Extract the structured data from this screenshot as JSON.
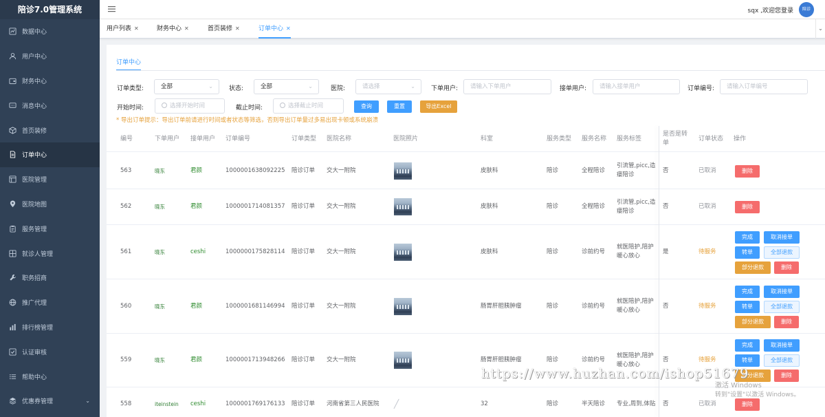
{
  "app": {
    "title": "陪诊7.0管理系统"
  },
  "sidebar": {
    "items": [
      {
        "label": "数据中心",
        "icon": "chart-icon"
      },
      {
        "label": "用户中心",
        "icon": "user-icon"
      },
      {
        "label": "财务中心",
        "icon": "wallet-icon"
      },
      {
        "label": "消息中心",
        "icon": "message-icon"
      },
      {
        "label": "首页装修",
        "icon": "box-icon"
      },
      {
        "label": "订单中心",
        "icon": "document-icon",
        "active": true
      },
      {
        "label": "医院管理",
        "icon": "hospital-icon"
      },
      {
        "label": "医院地图",
        "icon": "map-pin-icon"
      },
      {
        "label": "服务管理",
        "icon": "clipboard-icon"
      },
      {
        "label": "就诊人管理",
        "icon": "patients-icon"
      },
      {
        "label": "职务招商",
        "icon": "tool-icon"
      },
      {
        "label": "推广代理",
        "icon": "globe-icon"
      },
      {
        "label": "排行榜管理",
        "icon": "bar-chart-icon"
      },
      {
        "label": "认证审核",
        "icon": "check-square-icon"
      },
      {
        "label": "帮助中心",
        "icon": "list-icon"
      },
      {
        "label": "优惠券管理",
        "icon": "coupon-icon",
        "has_submenu": true
      }
    ]
  },
  "header": {
    "welcome": "sqx ,欢迎您登录",
    "avatar_text": "陪诊"
  },
  "tabs": [
    {
      "label": "用户列表"
    },
    {
      "label": "财务中心"
    },
    {
      "label": "首页装修"
    },
    {
      "label": "订单中心",
      "active": true
    }
  ],
  "panel": {
    "title": "订单中心"
  },
  "filters": {
    "order_type": {
      "label": "订单类型:",
      "value": "全部"
    },
    "status": {
      "label": "状态:",
      "value": "全部"
    },
    "hospital": {
      "label": "医院:",
      "placeholder": "请选择"
    },
    "order_user": {
      "label": "下单用户:",
      "placeholder": "请输入下单用户"
    },
    "accept_user": {
      "label": "接单用户:",
      "placeholder": "请输入接单用户"
    },
    "order_no": {
      "label": "订单编号:",
      "placeholder": "请输入订单编号"
    },
    "start_time": {
      "label": "开始时间:",
      "placeholder": "选择开始时间"
    },
    "end_time": {
      "label": "截止时间:",
      "placeholder": "选择截止时间"
    },
    "buttons": {
      "query": "查询",
      "reset": "重置",
      "export": "导出Excel"
    },
    "tip": "* 导出订单提示：导出订单前请进行时间或者状态等筛选，否则导出订单量过多易出现卡顿或系统崩溃"
  },
  "table": {
    "columns": {
      "id": "编号",
      "order_user": "下单用户",
      "accept_user": "接单用户",
      "order_no": "订单编号",
      "order_type": "订单类型",
      "hospital": "医院名称",
      "photo": "医院照片",
      "dept": "科室",
      "service_type": "服务类型",
      "service_name": "服务名称",
      "service_tag": "服务标签",
      "transfer": "是否是转单",
      "status": "订单状态",
      "actions": "操作"
    },
    "action_labels": {
      "complete": "完成",
      "cancel_accept": "取消接单",
      "transfer": "转单",
      "refund_all": "全部退款",
      "refund_part": "部分退款",
      "delete": "删除"
    },
    "rows": [
      {
        "id": "563",
        "order_user": "晓东",
        "accept_user": "君颜",
        "order_no": "1000001638092225",
        "order_type": "陪诊订单",
        "hospital": "交大一附院",
        "has_photo": true,
        "dept": "皮肤科",
        "service_type": "陪诊",
        "service_name": "全程陪诊",
        "service_tag": "引流管,picc,造瘘陪诊",
        "transfer": "否",
        "status": "已取消"
      },
      {
        "id": "562",
        "order_user": "晓东",
        "accept_user": "君颜",
        "order_no": "1000001714081357",
        "order_type": "陪诊订单",
        "hospital": "交大一附院",
        "has_photo": true,
        "dept": "皮肤科",
        "service_type": "陪诊",
        "service_name": "全程陪诊",
        "service_tag": "引流管,picc,造瘘陪诊",
        "transfer": "否",
        "status": "已取消"
      },
      {
        "id": "561",
        "order_user": "晓东",
        "accept_user": "ceshi",
        "order_no": "1000000175828114",
        "order_type": "陪诊订单",
        "hospital": "交大一附院",
        "has_photo": true,
        "dept": "皮肤科",
        "service_type": "陪诊",
        "service_name": "诊前约号",
        "service_tag": "就医陪护,陪护暖心放心",
        "transfer": "是",
        "status": "待服务"
      },
      {
        "id": "560",
        "order_user": "晓东",
        "accept_user": "君颜",
        "order_no": "1000001681146994",
        "order_type": "陪诊订单",
        "hospital": "交大一附院",
        "has_photo": true,
        "dept": "肠胃肝胆胰肿瘤",
        "service_type": "陪诊",
        "service_name": "诊前约号",
        "service_tag": "就医陪护,陪护暖心放心",
        "transfer": "否",
        "status": "待服务"
      },
      {
        "id": "559",
        "order_user": "晓东",
        "accept_user": "君颜",
        "order_no": "1000001713948266",
        "order_type": "陪诊订单",
        "hospital": "交大一附院",
        "has_photo": true,
        "dept": "肠胃肝胆胰肿瘤",
        "service_type": "陪诊",
        "service_name": "诊前约号",
        "service_tag": "就医陪护,陪护暖心放心",
        "transfer": "否",
        "status": "待服务"
      },
      {
        "id": "558",
        "order_user": "iteinstein",
        "accept_user": "ceshi",
        "order_no": "1000001769176133",
        "order_type": "陪诊订单",
        "hospital": "河南省第三人民医院",
        "has_photo": false,
        "dept": "32",
        "service_type": "陪诊",
        "service_name": "半天陪诊",
        "service_tag": "专业,周到,体贴",
        "transfer": "否",
        "status": "已取消"
      }
    ]
  },
  "overlay": {
    "watermark": "https://www.huzhan.com/ishop51679",
    "windows_activate_1": "激活 Windows",
    "windows_activate_2": "转到\"设置\"以激活 Windows。"
  }
}
